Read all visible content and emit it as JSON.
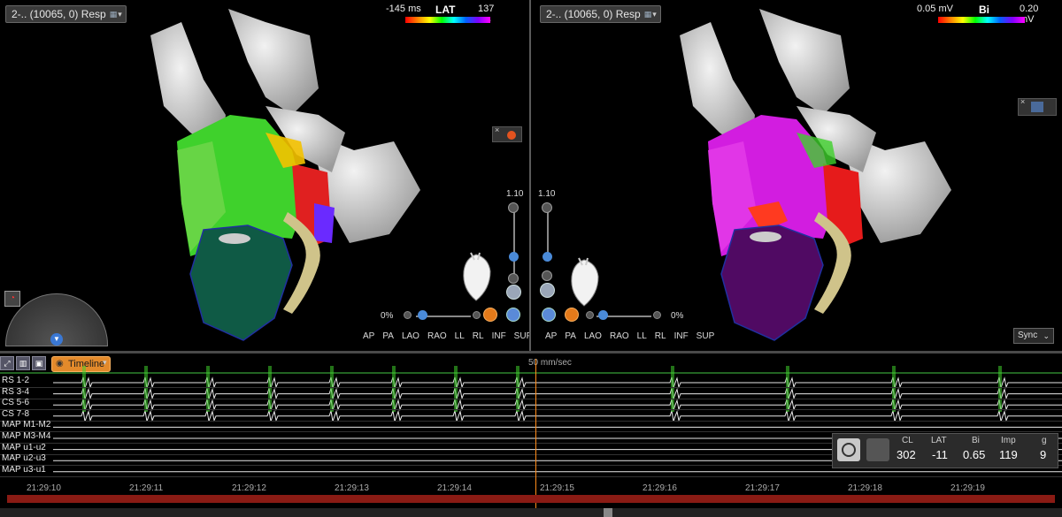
{
  "left_map": {
    "selector_label": "2-.. (10065, 0) Resp",
    "scale": {
      "title": "LAT",
      "min_label": "-145 ms",
      "max_label": "137 ms"
    },
    "zoom": "1.10",
    "opacity": "0%",
    "views": [
      "AP",
      "PA",
      "LAO",
      "RAO",
      "LL",
      "RL",
      "INF",
      "SUP"
    ]
  },
  "right_map": {
    "selector_label": "2-.. (10065, 0) Resp",
    "scale": {
      "title": "Bi",
      "min_label": "0.05 mV",
      "max_label": "0.20 mV"
    },
    "zoom": "1.10",
    "opacity": "0%",
    "views": [
      "AP",
      "PA",
      "LAO",
      "RAO",
      "LL",
      "RL",
      "INF",
      "SUP"
    ],
    "sync_label": "Sync"
  },
  "ecg": {
    "timeline_label": "Timeline",
    "speed_label": "50 mm/sec",
    "channels": [
      "RS 1-2",
      "RS 3-4",
      "CS 5-6",
      "CS 7-8",
      "MAP M1-M2",
      "MAP M3-M4",
      "MAP u1-u2",
      "MAP u2-u3",
      "MAP u3-u1"
    ],
    "times": [
      "21:29:10",
      "21:29:11",
      "21:29:12",
      "21:29:13",
      "21:29:14",
      "21:29:15",
      "21:29:16",
      "21:29:17",
      "21:29:18",
      "21:29:19"
    ]
  },
  "readout": {
    "headers": [
      "CL",
      "LAT",
      "Bi",
      "Imp",
      "g"
    ],
    "values": [
      "302",
      "-11",
      "0.65",
      "119",
      "9"
    ]
  },
  "icons": [
    "gear-icon",
    "heart-icon",
    "nav-wheel-icon",
    "chevron-down-icon",
    "close-icon"
  ],
  "colors": {
    "timeline": "#e38a2b",
    "cursor": "#ff8c1a",
    "redbar": "#8a1b14"
  }
}
